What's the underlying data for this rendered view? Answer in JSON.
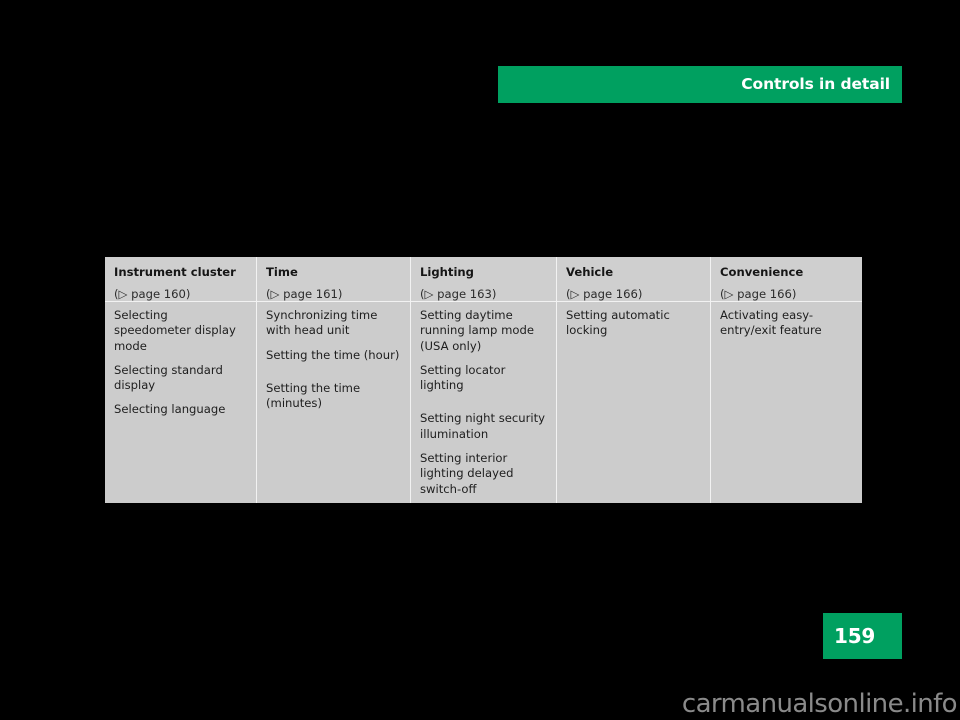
{
  "header": {
    "title": "Controls in detail",
    "accent_color": "#00a060"
  },
  "table": {
    "ref_arrow": "▷",
    "columns": [
      {
        "title": "Instrument cluster",
        "page_ref": "(▷ page 160)",
        "items": [
          {
            "text": "Selecting speedometer display mode",
            "gap_before": false
          },
          {
            "text": "Selecting standard display",
            "gap_before": false
          },
          {
            "text": "Selecting language",
            "gap_before": false
          }
        ]
      },
      {
        "title": "Time",
        "page_ref": "(▷ page 161)",
        "items": [
          {
            "text": "Synchronizing time with head unit",
            "gap_before": false
          },
          {
            "text": "Setting the time (hour)",
            "gap_before": false
          },
          {
            "text": "Setting the time (minutes)",
            "gap_before": true
          }
        ]
      },
      {
        "title": "Lighting",
        "page_ref": "(▷ page 163)",
        "items": [
          {
            "text": "Setting daytime running lamp mode (USA only)",
            "gap_before": false
          },
          {
            "text": "Setting locator lighting",
            "gap_before": false
          },
          {
            "text": "Setting night security illumination",
            "gap_before": true
          },
          {
            "text": "Setting interior lighting delayed switch-off",
            "gap_before": false
          }
        ]
      },
      {
        "title": "Vehicle",
        "page_ref": "(▷ page 166)",
        "items": [
          {
            "text": "Setting automatic locking",
            "gap_before": false
          }
        ]
      },
      {
        "title": "Convenience",
        "page_ref": "(▷ page 166)",
        "items": [
          {
            "text": "Activating easy-entry/exit feature",
            "gap_before": false
          }
        ]
      }
    ]
  },
  "footer": {
    "page_number": "159",
    "watermark": "carmanualsonline.info"
  }
}
